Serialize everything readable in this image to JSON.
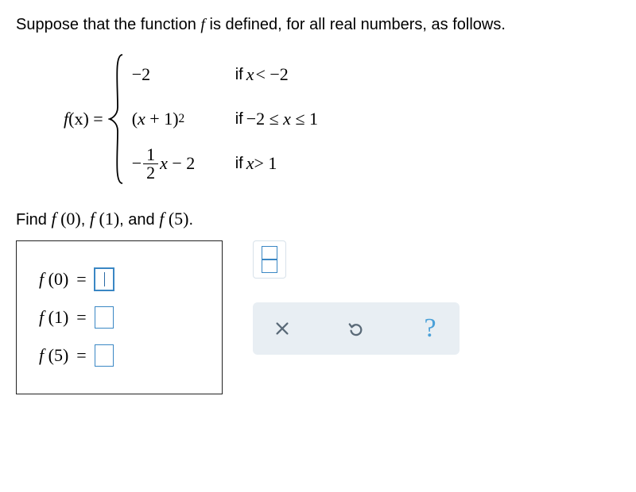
{
  "intro": {
    "prefix": "Suppose that the function ",
    "funcvar": "f",
    "suffix": " is defined, for all real numbers, as follows."
  },
  "piecewise": {
    "lhs_f": "f",
    "lhs_paren": "(x) =",
    "rows": [
      {
        "expr_plain": "−2",
        "cond_prefix": "if ",
        "cond": "x < −2"
      },
      {
        "expr_pre": "(x + 1)",
        "expr_sup": "2",
        "cond_prefix": "if ",
        "cond": "−2 ≤ x ≤ 1"
      },
      {
        "expr_neg": "−",
        "frac_num": "1",
        "frac_den": "2",
        "expr_post": "x − 2",
        "cond_prefix": "if ",
        "cond": "x > 1"
      }
    ]
  },
  "find": {
    "prefix": "Find ",
    "f0": "f (0)",
    "f1": "f (1)",
    "f5": "f (5)",
    "sep": ", ",
    "and": ", and ",
    "period": "."
  },
  "answers": [
    {
      "label_f": "f",
      "label_arg": "(0)",
      "eq": "=",
      "active": true
    },
    {
      "label_f": "f",
      "label_arg": "(1)",
      "eq": "=",
      "active": false
    },
    {
      "label_f": "f",
      "label_arg": "(5)",
      "eq": "=",
      "active": false
    }
  ],
  "toolbar": {
    "fraction_tool": "fraction",
    "clear": "clear",
    "undo": "undo",
    "help": "?"
  }
}
